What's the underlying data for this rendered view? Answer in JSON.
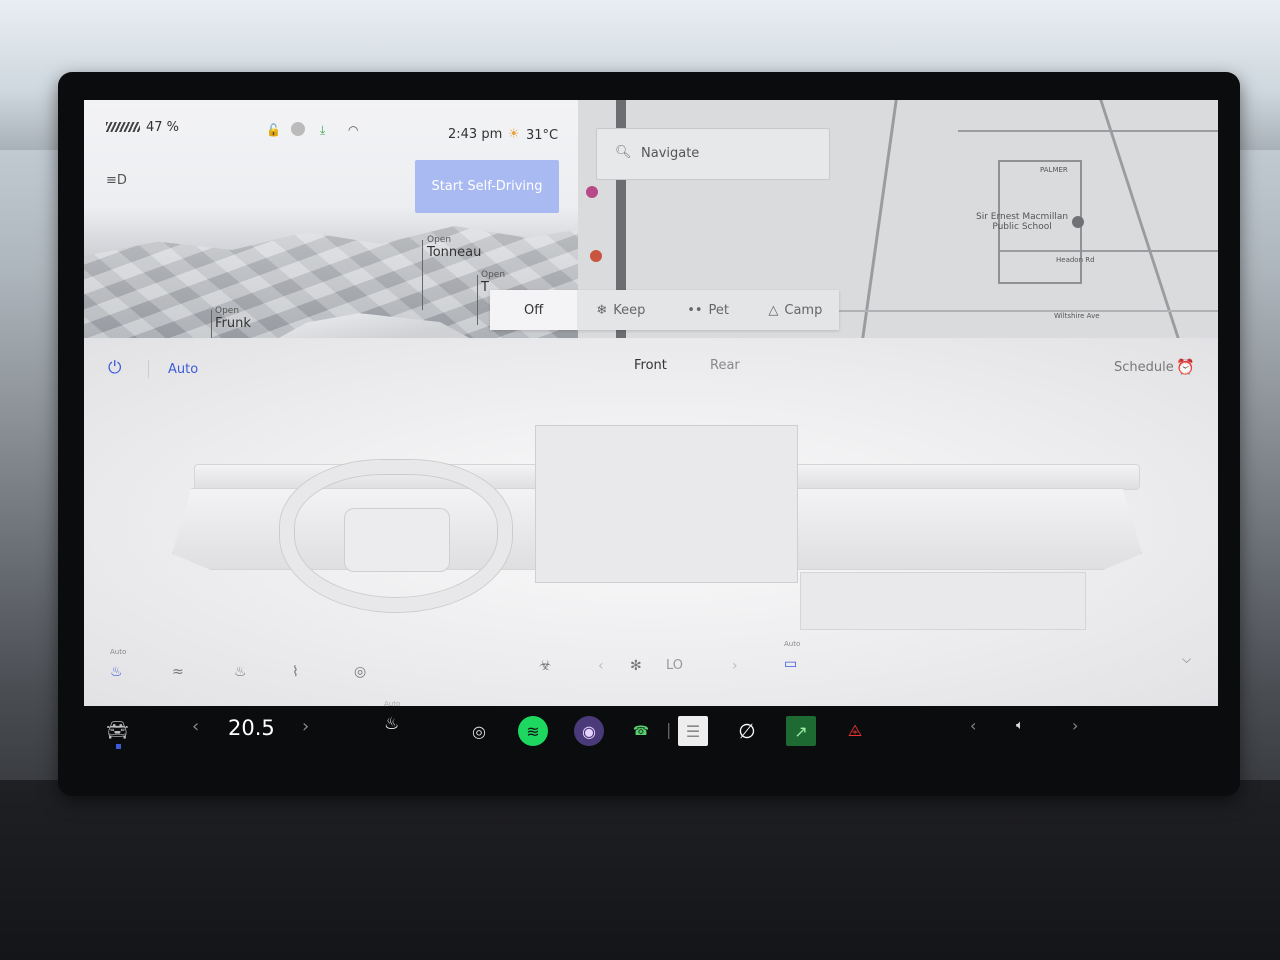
{
  "status": {
    "battery_percent": "47 %",
    "time": "2:43 pm",
    "temperature": "31°C"
  },
  "car_panel": {
    "self_driving_button": "Start Self-Driving",
    "tonneau": {
      "state": "Open",
      "label": "Tonneau"
    },
    "tailgate": {
      "state": "Open",
      "label": "T"
    },
    "frunk": {
      "state": "Open",
      "label": "Frunk"
    }
  },
  "map": {
    "search_placeholder": "Navigate",
    "poi_school": "Sir Ernest Macmillan\nPublic School",
    "street_palmer": "PALMER",
    "street_headon": "Headon Rd",
    "street_wiltshire": "Wiltshire Ave"
  },
  "modes": [
    {
      "label": "Off",
      "icon": ""
    },
    {
      "label": "Keep",
      "icon": "keep-icon"
    },
    {
      "label": "Pet",
      "icon": "paw-icon"
    },
    {
      "label": "Camp",
      "icon": "tent-icon"
    }
  ],
  "climate": {
    "auto_label": "Auto",
    "tab_front": "Front",
    "tab_rear": "Rear",
    "schedule_label": "Schedule",
    "fan_level": "LO",
    "seat_auto_label": "Auto",
    "defrost_auto_label": "Auto"
  },
  "taskbar": {
    "temperature": "20.5",
    "seat_auto_label": "Auto"
  },
  "colors": {
    "accent_blue": "#3d5bd8",
    "self_driving_btn": "#a9b9f1",
    "spotify_green": "#1ed760"
  }
}
